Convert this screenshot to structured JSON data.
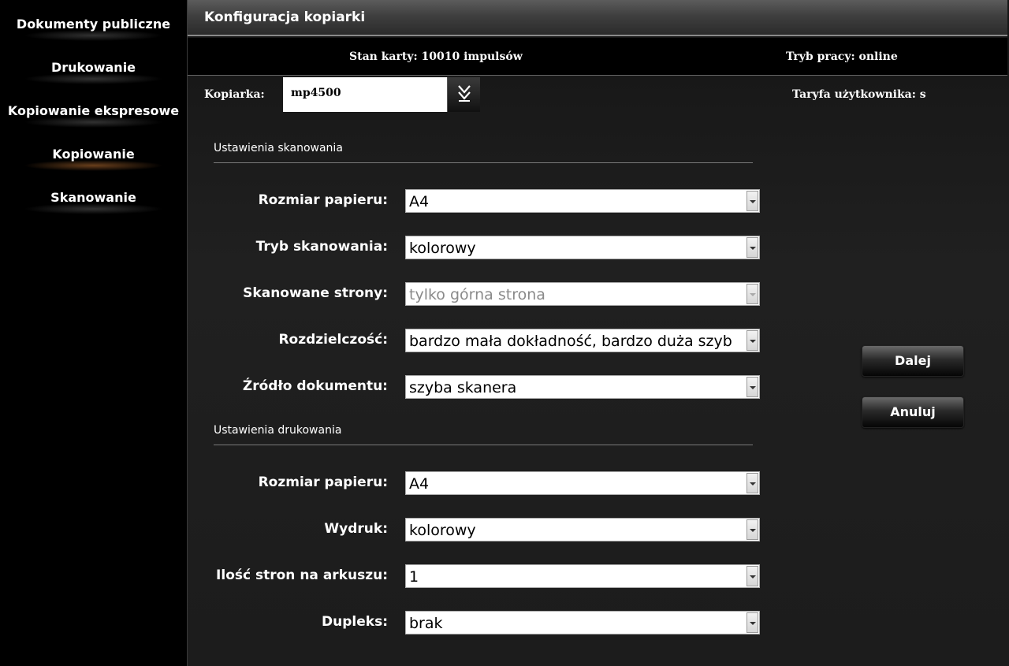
{
  "sidebar": {
    "items": [
      {
        "label": "Dokumenty publiczne",
        "active": false
      },
      {
        "label": "Drukowanie",
        "active": false
      },
      {
        "label": "Kopiowanie ekspresowe",
        "active": false
      },
      {
        "label": "Kopiowanie",
        "active": true
      },
      {
        "label": "Skanowanie",
        "active": false
      }
    ]
  },
  "header": {
    "title": "Konfiguracja kopiarki"
  },
  "status": {
    "card": "Stan karty: 10010 impulsów",
    "mode": "Tryb pracy: online",
    "tariff": "Taryfa użytkownika: s"
  },
  "copier": {
    "label": "Kopiarka:",
    "value": "mp4500",
    "dropdown_icon": "double-chevron-down-icon"
  },
  "scan_settings": {
    "title": "Ustawienia skanowania",
    "fields": [
      {
        "label": "Rozmiar papieru:",
        "value": "A4",
        "disabled": false
      },
      {
        "label": "Tryb skanowania:",
        "value": "kolorowy",
        "disabled": false
      },
      {
        "label": "Skanowane strony:",
        "value": "tylko górna strona",
        "disabled": true
      },
      {
        "label": "Rozdzielczość:",
        "value": "bardzo mała dokładność, bardzo duża szyb",
        "disabled": false
      },
      {
        "label": "Źródło dokumentu:",
        "value": "szyba skanera",
        "disabled": false
      }
    ]
  },
  "print_settings": {
    "title": "Ustawienia drukowania",
    "fields": [
      {
        "label": "Rozmiar papieru:",
        "value": "A4",
        "disabled": false
      },
      {
        "label": "Wydruk:",
        "value": "kolorowy",
        "disabled": false
      },
      {
        "label": "Ilość stron na arkuszu:",
        "value": "1",
        "disabled": false
      },
      {
        "label": "Dupleks:",
        "value": "brak",
        "disabled": false
      }
    ]
  },
  "actions": {
    "next_label": "Dalej",
    "cancel_label": "Anuluj"
  }
}
